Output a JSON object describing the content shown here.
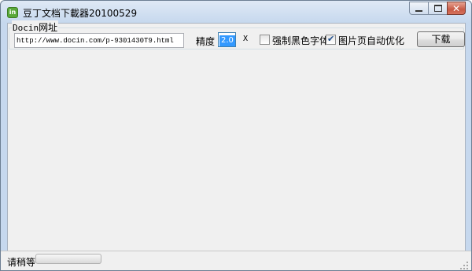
{
  "window": {
    "title": "豆丁文档下載器20100529",
    "close_glyph": "✕"
  },
  "group": {
    "label_latin": "Docin",
    "label_cjk": "网址"
  },
  "url_field": {
    "value": "http://www.docin.com/p-9301430T9.html"
  },
  "precision": {
    "label": "精度",
    "value": "2.0",
    "unit": "X"
  },
  "options": [
    {
      "label": "强制黑色字体",
      "checked": false
    },
    {
      "label": "图片页自动优化",
      "checked": true
    }
  ],
  "download": {
    "label": "下载"
  },
  "status": {
    "text": "请稍等",
    "progress": 0
  },
  "icons": {
    "app": "app-icon",
    "check": "✔"
  }
}
